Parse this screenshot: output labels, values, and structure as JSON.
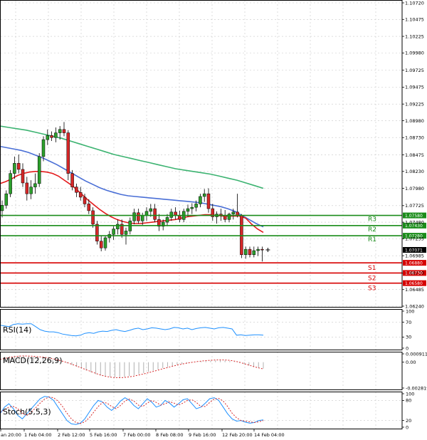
{
  "chart_data": {
    "type": "candlestick",
    "main": {
      "price_ticks": [
        "1.10720",
        "1.10475",
        "1.10225",
        "1.09980",
        "1.09725",
        "1.09475",
        "1.09225",
        "1.08980",
        "1.08730",
        "1.08475",
        "1.08230",
        "1.07980",
        "1.07725",
        "1.07480",
        "1.07235",
        "1.06985",
        "1.06730",
        "1.06485",
        "1.06240"
      ],
      "ylim": [
        1.0624,
        1.1072
      ],
      "candles": [
        [
          1.0765,
          1.078,
          1.0755,
          1.0773
        ],
        [
          1.0773,
          1.0795,
          1.0768,
          1.079
        ],
        [
          1.079,
          1.0825,
          1.0785,
          1.082
        ],
        [
          1.082,
          1.0845,
          1.0812,
          1.0835
        ],
        [
          1.0835,
          1.0848,
          1.082,
          1.0826
        ],
        [
          1.0826,
          1.0835,
          1.08,
          1.0806
        ],
        [
          1.0806,
          1.0815,
          1.078,
          1.079
        ],
        [
          1.079,
          1.081,
          1.0782,
          1.08
        ],
        [
          1.08,
          1.082,
          1.079,
          1.0805
        ],
        [
          1.0805,
          1.085,
          1.08,
          1.0845
        ],
        [
          1.0845,
          1.0875,
          1.0838,
          1.087
        ],
        [
          1.087,
          1.0885,
          1.0862,
          1.0876
        ],
        [
          1.0876,
          1.0882,
          1.0868,
          1.0873
        ],
        [
          1.0873,
          1.0888,
          1.0866,
          1.088
        ],
        [
          1.088,
          1.089,
          1.087,
          1.0885
        ],
        [
          1.0885,
          1.0896,
          1.0875,
          1.088
        ],
        [
          1.088,
          1.0884,
          1.081,
          1.082
        ],
        [
          1.082,
          1.0825,
          1.0795,
          1.08
        ],
        [
          1.08,
          1.0805,
          1.0785,
          1.0792
        ],
        [
          1.0792,
          1.08,
          1.078,
          1.0785
        ],
        [
          1.0785,
          1.079,
          1.077,
          1.0775
        ],
        [
          1.0775,
          1.0782,
          1.076,
          1.0765
        ],
        [
          1.0765,
          1.077,
          1.074,
          1.0745
        ],
        [
          1.0745,
          1.075,
          1.0715,
          1.072
        ],
        [
          1.072,
          1.0728,
          1.0705,
          1.071
        ],
        [
          1.071,
          1.0728,
          1.0706,
          1.0725
        ],
        [
          1.0725,
          1.0735,
          1.0718,
          1.073
        ],
        [
          1.073,
          1.0742,
          1.0722,
          1.0738
        ],
        [
          1.0738,
          1.0752,
          1.073,
          1.0745
        ],
        [
          1.0745,
          1.0752,
          1.0725,
          1.073
        ],
        [
          1.073,
          1.074,
          1.0715,
          1.0735
        ],
        [
          1.0735,
          1.0755,
          1.073,
          1.075
        ],
        [
          1.075,
          1.0768,
          1.0745,
          1.0762
        ],
        [
          1.0762,
          1.0768,
          1.0746,
          1.075
        ],
        [
          1.075,
          1.0762,
          1.0744,
          1.0758
        ],
        [
          1.0758,
          1.077,
          1.075,
          1.0764
        ],
        [
          1.0764,
          1.0775,
          1.0756,
          1.0768
        ],
        [
          1.0768,
          1.0775,
          1.0748,
          1.0752
        ],
        [
          1.0752,
          1.076,
          1.0735,
          1.0742
        ],
        [
          1.0742,
          1.0752,
          1.0736,
          1.0748
        ],
        [
          1.0748,
          1.076,
          1.0742,
          1.0755
        ],
        [
          1.0755,
          1.0768,
          1.075,
          1.0763
        ],
        [
          1.0763,
          1.077,
          1.0752,
          1.0758
        ],
        [
          1.0758,
          1.0765,
          1.0748,
          1.0752
        ],
        [
          1.0752,
          1.0768,
          1.0748,
          1.0764
        ],
        [
          1.0764,
          1.0774,
          1.0756,
          1.0768
        ],
        [
          1.0768,
          1.0776,
          1.076,
          1.077
        ],
        [
          1.077,
          1.078,
          1.0764,
          1.0775
        ],
        [
          1.0775,
          1.079,
          1.077,
          1.0786
        ],
        [
          1.0786,
          1.0797,
          1.0778,
          1.079
        ],
        [
          1.079,
          1.0798,
          1.0762,
          1.0768
        ],
        [
          1.0768,
          1.0775,
          1.075,
          1.0756
        ],
        [
          1.0756,
          1.0764,
          1.0746,
          1.076
        ],
        [
          1.076,
          1.0768,
          1.075,
          1.0758
        ],
        [
          1.0758,
          1.0766,
          1.0748,
          1.0752
        ],
        [
          1.0752,
          1.0762,
          1.0748,
          1.076
        ],
        [
          1.076,
          1.0768,
          1.0752,
          1.0763
        ],
        [
          1.0763,
          1.079,
          1.0755,
          1.0758
        ],
        [
          1.0758,
          1.076,
          1.0695,
          1.07
        ],
        [
          1.07,
          1.0712,
          1.0694,
          1.0708
        ],
        [
          1.0708,
          1.0712,
          1.0696,
          1.07
        ],
        [
          1.07,
          1.0712,
          1.0696,
          1.0706
        ],
        [
          1.0706,
          1.0712,
          1.0698,
          1.0708
        ],
        [
          1.0708,
          1.0712,
          1.069,
          1.0707
        ]
      ],
      "ma_fast": [
        1.0805,
        1.0808,
        1.0812,
        1.0817,
        1.082,
        1.0822,
        1.0823,
        1.0823,
        1.0822,
        1.082,
        1.0816,
        1.081,
        1.0804,
        1.0797,
        1.0789,
        1.0781,
        1.0774,
        1.0767,
        1.0761,
        1.0756,
        1.0752,
        1.0749,
        1.0747,
        1.0746,
        1.0746,
        1.0747,
        1.0748,
        1.0749,
        1.075,
        1.0751,
        1.0752,
        1.0754,
        1.0756,
        1.0757,
        1.0758,
        1.0759,
        1.0759,
        1.0758,
        1.0757,
        1.0757,
        1.0757,
        1.0757,
        1.0754,
        1.0745,
        1.0738,
        1.0733
      ],
      "ma_mid": [
        1.086,
        1.0858,
        1.0856,
        1.0854,
        1.0851,
        1.0847,
        1.0843,
        1.0838,
        1.0833,
        1.0827,
        1.0821,
        1.0815,
        1.0809,
        1.0804,
        1.0799,
        1.0795,
        1.0792,
        1.0789,
        1.0787,
        1.0786,
        1.0785,
        1.0784,
        1.0783,
        1.0782,
        1.0781,
        1.078,
        1.0779,
        1.0778,
        1.0777,
        1.0775,
        1.0773,
        1.0771,
        1.0768,
        1.0764,
        1.0758,
        1.0752,
        1.0746,
        1.0741
      ],
      "ma_slow": [
        1.089,
        1.0888,
        1.0886,
        1.0884,
        1.0881,
        1.0878,
        1.0875,
        1.0872,
        1.0868,
        1.0864,
        1.086,
        1.0856,
        1.0852,
        1.0848,
        1.0845,
        1.0842,
        1.0839,
        1.0836,
        1.0833,
        1.083,
        1.0827,
        1.0825,
        1.0823,
        1.0821,
        1.0819,
        1.0816,
        1.0813,
        1.081,
        1.0806,
        1.0802,
        1.0798
      ],
      "current_price": "1.07071",
      "resistance": [
        {
          "label": "R3",
          "value": 1.0758,
          "tag": "1.07580"
        },
        {
          "label": "R2",
          "value": 1.0743,
          "tag": "1.07430"
        },
        {
          "label": "R1",
          "value": 1.0728,
          "tag": "1.07280"
        }
      ],
      "support": [
        {
          "label": "S1",
          "value": 1.0688,
          "tag": "1.06880"
        },
        {
          "label": "S2",
          "value": 1.0673,
          "tag": "1.06730"
        },
        {
          "label": "S3",
          "value": 1.0658,
          "tag": "1.06580"
        }
      ]
    },
    "rsi": {
      "title": "RSI(14)",
      "ticks": [
        "100",
        "70",
        "30",
        "0"
      ],
      "values": [
        62,
        60,
        58,
        64,
        66,
        65,
        66,
        66,
        58,
        50,
        46,
        44,
        44,
        42,
        38,
        36,
        34,
        33,
        35,
        40,
        42,
        40,
        44,
        46,
        45,
        48,
        50,
        47,
        45,
        48,
        52,
        54,
        50,
        52,
        55,
        54,
        52,
        50,
        52,
        56,
        55,
        52,
        54,
        50,
        53,
        55,
        56,
        54,
        52,
        55,
        56,
        54,
        52,
        35,
        36,
        34,
        35,
        36,
        36,
        35
      ]
    },
    "macd": {
      "title": "MACD(12,26,9)",
      "ticks": [
        "0.000911",
        "0.00",
        "-0.002819"
      ],
      "histogram": [
        0.00045,
        0.0006,
        0.00065,
        0.0007,
        0.00072,
        0.0007,
        0.00066,
        0.0006,
        0.00054,
        0.00048,
        0.0004,
        0.00028,
        0.00015,
        2e-05,
        -0.00012,
        -0.0003,
        -0.0005,
        -0.0007,
        -0.0009,
        -0.0011,
        -0.0013,
        -0.00145,
        -0.00155,
        -0.00162,
        -0.00165,
        -0.00165,
        -0.0016,
        -0.00152,
        -0.00142,
        -0.0013,
        -0.00118,
        -0.00105,
        -0.00092,
        -0.00078,
        -0.00064,
        -0.00052,
        -0.0004,
        -0.0003,
        -0.0002,
        -0.00012,
        -5e-05,
        2e-05,
        8e-05,
        0.00012,
        0.00016,
        0.00018,
        0.0002,
        0.00018,
        0.00012,
        4e-05,
        -8e-05,
        -0.00022,
        -0.00036,
        -0.0005,
        -0.00062,
        -0.0007
      ],
      "signal": [
        0.0003,
        0.00042,
        0.00052,
        0.0006,
        0.00066,
        0.00068,
        0.00067,
        0.00064,
        0.0006,
        0.00055,
        0.00048,
        0.00038,
        0.00026,
        0.00012,
        -4e-05,
        -0.00022,
        -0.00042,
        -0.00062,
        -0.00082,
        -0.00102,
        -0.00122,
        -0.0014,
        -0.00154,
        -0.00163,
        -0.00168,
        -0.00169,
        -0.00166,
        -0.0016,
        -0.00151,
        -0.0014,
        -0.00128,
        -0.00115,
        -0.00101,
        -0.00087,
        -0.00072,
        -0.00058,
        -0.00044,
        -0.00032,
        -0.00021,
        -0.00011,
        -2e-05,
        6e-05,
        0.00012,
        0.00017,
        0.00021,
        0.00024,
        0.00025,
        0.00024,
        0.0002,
        0.00012,
        0.0,
        -0.00016,
        -0.00032,
        -0.00048,
        -0.00062,
        -0.00074
      ]
    },
    "stoch": {
      "title": "Stoch(5,5,3)",
      "ticks": [
        "100",
        "80",
        "20",
        "0"
      ],
      "k": [
        40,
        60,
        70,
        55,
        35,
        25,
        40,
        55,
        70,
        85,
        92,
        90,
        80,
        60,
        40,
        20,
        10,
        8,
        12,
        25,
        45,
        65,
        80,
        75,
        60,
        50,
        62,
        78,
        88,
        80,
        65,
        55,
        70,
        85,
        75,
        60,
        65,
        80,
        72,
        60,
        70,
        82,
        85,
        70,
        55,
        60,
        72,
        85,
        88,
        80,
        60,
        40,
        25,
        18,
        20,
        15,
        12,
        14,
        20,
        22
      ],
      "d": [
        45,
        52,
        60,
        62,
        55,
        42,
        35,
        45,
        58,
        72,
        84,
        90,
        88,
        78,
        62,
        42,
        25,
        14,
        11,
        16,
        28,
        45,
        62,
        74,
        72,
        62,
        55,
        65,
        78,
        84,
        78,
        66,
        62,
        72,
        80,
        74,
        66,
        70,
        76,
        72,
        66,
        72,
        80,
        82,
        74,
        62,
        62,
        74,
        84,
        86,
        78,
        62,
        42,
        28,
        20,
        18,
        16,
        14,
        16,
        20
      ]
    },
    "time_labels": [
      "an 20:00",
      "1 Feb 04:00",
      "2 Feb 12:00",
      "5 Feb 16:00",
      "7 Feb 00:00",
      "8 Feb 08:00",
      "9 Feb 16:00",
      "12 Feb 20:00",
      "14 Feb 04:00"
    ],
    "grid": true,
    "colors": {
      "ma_fast": "#e31a1c",
      "ma_mid": "#4a6fd6",
      "ma_slow": "#3cb371",
      "bull": "#2ca02c",
      "bear": "#d62728",
      "resistance": "#1a8c1a",
      "support": "#d60000",
      "indicator_line": "#1e90ff",
      "macd_signal": "#d62728",
      "stoch_k": "#1e90ff",
      "stoch_d": "#d62728",
      "current_tag": "#000000"
    }
  }
}
